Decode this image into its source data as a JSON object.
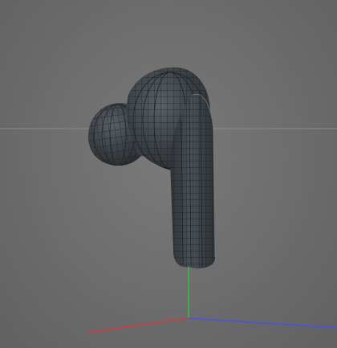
{
  "viewport": {
    "background_color": "#6d6d6d",
    "horizon_line_color": "#8a8a8a",
    "model": {
      "name": "earbud-wireframe",
      "surface_color": "#3f4449",
      "wire_color": "#1e2226"
    },
    "axes": {
      "x_color": "#d33a3a",
      "y_color": "#37c23a",
      "z_color": "#4a52e6"
    }
  }
}
